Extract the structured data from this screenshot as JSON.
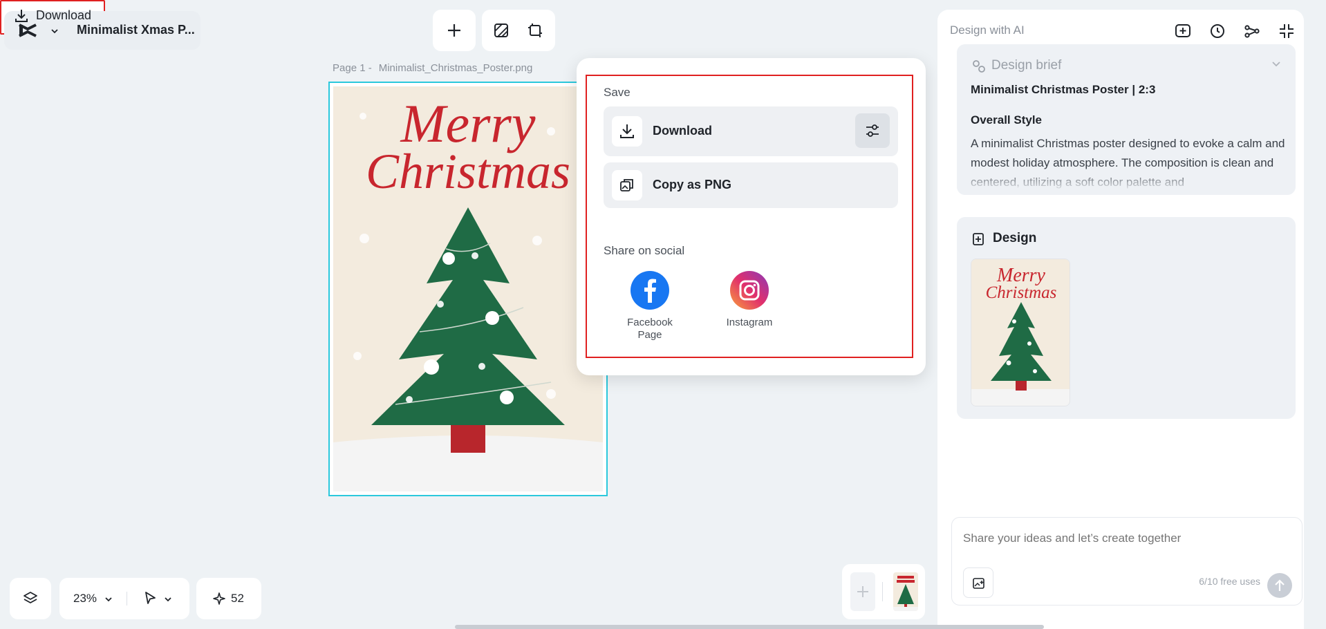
{
  "project": {
    "title": "Minimalist Xmas P..."
  },
  "toolbar": {
    "download_label": "Download"
  },
  "canvas": {
    "page_label": "Page 1 -",
    "file_name": "Minimalist_Christmas_Poster.png",
    "poster": {
      "line1": "Merry",
      "line2": "Christmas"
    }
  },
  "download_menu": {
    "save_title": "Save",
    "download_label": "Download",
    "copy_label": "Copy as PNG",
    "share_title": "Share on social",
    "social": [
      {
        "name": "Facebook Page",
        "icon": "facebook-icon",
        "color": "#1877f2"
      },
      {
        "name": "Instagram",
        "icon": "instagram-icon",
        "color": "#e1306c"
      }
    ]
  },
  "ai_panel": {
    "title": "Design with AI",
    "brief": {
      "heading": "Design brief",
      "title": "Minimalist Christmas Poster | 2:3",
      "style_heading": "Overall Style",
      "style_text": "A minimalist Christmas poster designed to evoke a calm and modest holiday atmosphere. The composition is clean and centered, utilizing a soft color palette and"
    },
    "design": {
      "heading": "Design"
    },
    "prompt": {
      "placeholder": "Share your ideas and let’s create together",
      "uses": "6/10 free uses"
    }
  },
  "bottom": {
    "zoom": "23%",
    "credits": "52"
  },
  "colors": {
    "accent_red": "#e02020",
    "selection_cyan": "#2ac8dc",
    "tree_green": "#1f6b45",
    "poster_red": "#c8262e"
  }
}
